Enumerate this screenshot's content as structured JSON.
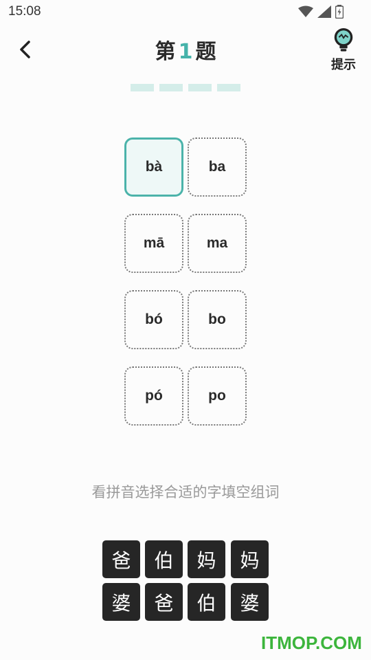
{
  "status": {
    "time": "15:08"
  },
  "header": {
    "title_prefix": "第",
    "question_number": "1",
    "title_suffix": "题",
    "hint_label": "提示"
  },
  "progress": {
    "segments": 4
  },
  "options": [
    {
      "pinyin": "bà",
      "selected": true
    },
    {
      "pinyin": "ba",
      "selected": false
    },
    {
      "pinyin": "mā",
      "selected": false
    },
    {
      "pinyin": "ma",
      "selected": false
    },
    {
      "pinyin": "bó",
      "selected": false
    },
    {
      "pinyin": "bo",
      "selected": false
    },
    {
      "pinyin": "pó",
      "selected": false
    },
    {
      "pinyin": "po",
      "selected": false
    }
  ],
  "instruction": "看拼音选择合适的字填空组词",
  "characters": [
    "爸",
    "伯",
    "妈",
    "妈",
    "婆",
    "爸",
    "伯",
    "婆"
  ],
  "watermark": "ITMOP.COM",
  "colors": {
    "accent": "#46b3aa",
    "tile": "#262626",
    "progress": "#d4ede9"
  }
}
